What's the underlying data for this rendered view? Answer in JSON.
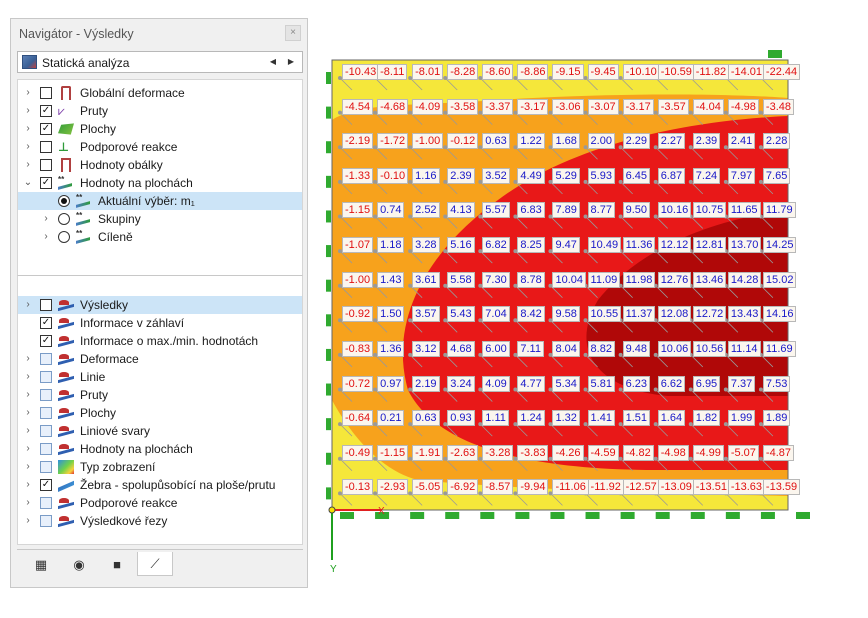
{
  "navigator": {
    "title": "Navigátor - Výsledky",
    "close_glyph": "×",
    "combo": {
      "value": "Statická analýza",
      "prev": "◀",
      "next": "▶"
    },
    "tree_top": [
      {
        "label": "Globální deformace",
        "checked": false,
        "expander": "›",
        "icon": "deformation-icon",
        "indent": 0
      },
      {
        "label": "Pruty",
        "checked": true,
        "expander": "›",
        "icon": "member-icon",
        "indent": 0
      },
      {
        "label": "Plochy",
        "checked": true,
        "expander": "›",
        "icon": "surface-icon",
        "indent": 0
      },
      {
        "label": "Podporové reakce",
        "checked": false,
        "expander": "›",
        "icon": "support-icon",
        "indent": 0
      },
      {
        "label": "Hodnoty obálky",
        "checked": false,
        "expander": "›",
        "icon": "envelope-icon",
        "indent": 0
      },
      {
        "label": "Hodnoty na plochách",
        "checked": true,
        "expander": "⌄",
        "icon": "surface-values-icon",
        "indent": 0
      },
      {
        "label": "Aktuální výběr: m₁",
        "radio": true,
        "selected": true,
        "expander": "",
        "icon": "surface-values-icon",
        "indent": 1
      },
      {
        "label": "Skupiny",
        "radio": true,
        "selected": false,
        "expander": "›",
        "icon": "surface-values-icon",
        "indent": 1
      },
      {
        "label": "Cíleně",
        "radio": true,
        "selected": false,
        "expander": "›",
        "icon": "target-icon",
        "indent": 1
      }
    ],
    "tree_bottom": [
      {
        "label": "Výsledky",
        "checked": false,
        "expander": "›",
        "icon": "results-values-icon",
        "selected": true
      },
      {
        "label": "Informace v záhlaví",
        "checked": true,
        "expander": "",
        "icon": "results-icon"
      },
      {
        "label": "Informace o max./min. hodnotách",
        "checked": true,
        "expander": "",
        "icon": "results-icon"
      },
      {
        "label": "Deformace",
        "checked": false,
        "partial": true,
        "expander": "›",
        "icon": "results-icon"
      },
      {
        "label": "Linie",
        "checked": false,
        "partial": true,
        "expander": "›",
        "icon": "results-icon"
      },
      {
        "label": "Pruty",
        "checked": false,
        "partial": true,
        "expander": "›",
        "icon": "results-icon"
      },
      {
        "label": "Plochy",
        "checked": false,
        "partial": true,
        "expander": "›",
        "icon": "results-icon"
      },
      {
        "label": "Liniové svary",
        "checked": false,
        "partial": true,
        "expander": "›",
        "icon": "results-icon"
      },
      {
        "label": "Hodnoty na plochách",
        "checked": false,
        "partial": true,
        "expander": "›",
        "icon": "results-icon"
      },
      {
        "label": "Typ zobrazení",
        "checked": false,
        "partial": true,
        "expander": "›",
        "icon": "gradient-icon"
      },
      {
        "label": "Žebra - spolupůsobící na ploše/prutu",
        "checked": true,
        "expander": "›",
        "icon": "rib-icon"
      },
      {
        "label": "Podporové reakce",
        "checked": false,
        "partial": true,
        "expander": "›",
        "icon": "results-icon"
      },
      {
        "label": "Výsledkové řezy",
        "checked": false,
        "partial": true,
        "expander": "›",
        "icon": "results-icon"
      }
    ],
    "bottom_tabs": [
      {
        "icon": "data-icon",
        "glyph": "▦"
      },
      {
        "icon": "eye-icon",
        "glyph": "◉"
      },
      {
        "icon": "camera-icon",
        "glyph": "■"
      },
      {
        "icon": "results-tab-icon",
        "glyph": "⟋",
        "active": true
      }
    ]
  },
  "canvas": {
    "axis_x": "X",
    "axis_y": "Y",
    "colors": {
      "yellow": "#f5e73a",
      "orange": "#f7a21c",
      "red": "#e81818",
      "darkred": "#b00808",
      "support": "#2faa2f"
    },
    "grid_values": [
      [
        "-10.43",
        "-8.11",
        "-8.01",
        "-8.28",
        "-8.60",
        "-8.86",
        "-9.15",
        "-9.45",
        "-10.10",
        "-10.59",
        "-11.82",
        "-14.01",
        "-22.44"
      ],
      [
        "-4.54",
        "-4.68",
        "-4.09",
        "-3.58",
        "-3.37",
        "-3.17",
        "-3.06",
        "-3.07",
        "-3.17",
        "-3.57",
        "-4.04",
        "-4.98",
        "-3.48"
      ],
      [
        "-2.19",
        "-1.72",
        "-1.00",
        "-0.12",
        "0.63",
        "1.22",
        "1.68",
        "2.00",
        "2.29",
        "2.27",
        "2.39",
        "2.41",
        "2.28"
      ],
      [
        "-1.33",
        "-0.10",
        "1.16",
        "2.39",
        "3.52",
        "4.49",
        "5.29",
        "5.93",
        "6.45",
        "6.87",
        "7.24",
        "7.97",
        "7.65"
      ],
      [
        "-1.15",
        "0.74",
        "2.52",
        "4.13",
        "5.57",
        "6.83",
        "7.89",
        "8.77",
        "9.50",
        "10.16",
        "10.75",
        "11.65",
        "11.79"
      ],
      [
        "-1.07",
        "1.18",
        "3.28",
        "5.16",
        "6.82",
        "8.25",
        "9.47",
        "10.49",
        "11.36",
        "12.12",
        "12.81",
        "13.70",
        "14.25"
      ],
      [
        "-1.00",
        "1.43",
        "3.61",
        "5.58",
        "7.30",
        "8.78",
        "10.04",
        "11.09",
        "11.98",
        "12.76",
        "13.46",
        "14.28",
        "15.02"
      ],
      [
        "-0.92",
        "1.50",
        "3.57",
        "5.43",
        "7.04",
        "8.42",
        "9.58",
        "10.55",
        "11.37",
        "12.08",
        "12.72",
        "13.43",
        "14.16"
      ],
      [
        "-0.83",
        "1.36",
        "3.12",
        "4.68",
        "6.00",
        "7.11",
        "8.04",
        "8.82",
        "9.48",
        "10.06",
        "10.56",
        "11.14",
        "11.69"
      ],
      [
        "-0.72",
        "0.97",
        "2.19",
        "3.24",
        "4.09",
        "4.77",
        "5.34",
        "5.81",
        "6.23",
        "6.62",
        "6.95",
        "7.37",
        "7.53"
      ],
      [
        "-0.64",
        "0.21",
        "0.63",
        "0.93",
        "1.11",
        "1.24",
        "1.32",
        "1.41",
        "1.51",
        "1.64",
        "1.82",
        "1.99",
        "1.89"
      ],
      [
        "-0.49",
        "-1.15",
        "-1.91",
        "-2.63",
        "-3.28",
        "-3.83",
        "-4.26",
        "-4.59",
        "-4.82",
        "-4.98",
        "-4.99",
        "-5.07",
        "-4.87"
      ],
      [
        "-0.13",
        "-2.93",
        "-5.05",
        "-6.92",
        "-8.57",
        "-9.94",
        "-11.06",
        "-11.92",
        "-12.57",
        "-13.09",
        "-13.51",
        "-13.63",
        "-13.59"
      ]
    ]
  }
}
